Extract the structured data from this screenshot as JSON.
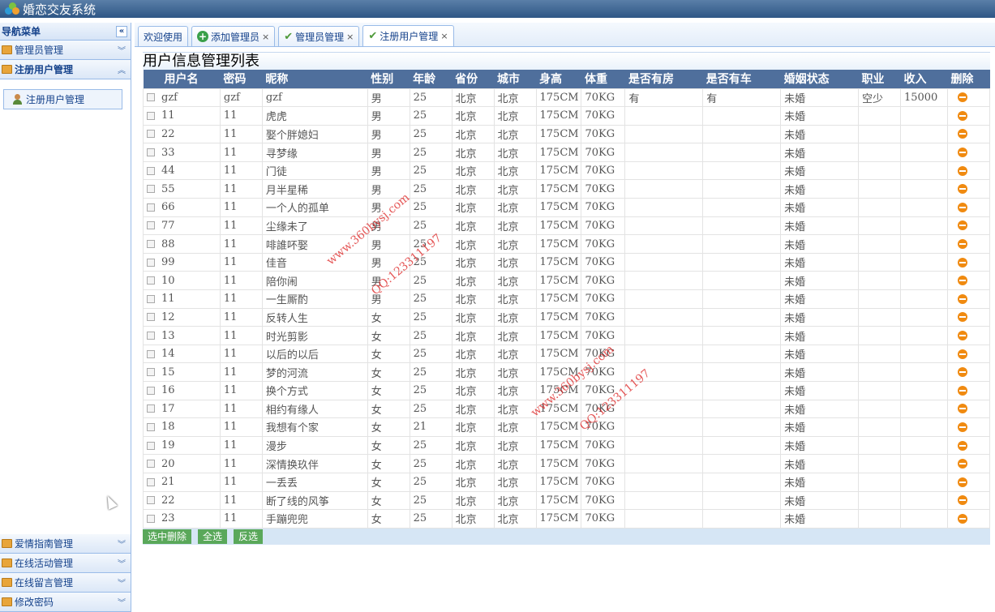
{
  "app": {
    "title": "婚恋交友系统"
  },
  "sidebar": {
    "header": "导航菜单",
    "collapse_glyph": "«",
    "sections": [
      {
        "label": "管理员管理",
        "chevron": "︾"
      },
      {
        "label": "注册用户管理",
        "chevron": "︽"
      }
    ],
    "sub_items": [
      {
        "label": "注册用户管理"
      }
    ],
    "bottom_sections": [
      {
        "label": "爱情指南管理",
        "chevron": "︾"
      },
      {
        "label": "在线活动管理",
        "chevron": "︾"
      },
      {
        "label": "在线留言管理",
        "chevron": "︾"
      },
      {
        "label": "修改密码",
        "chevron": "︾"
      }
    ]
  },
  "tabs": [
    {
      "label": "欢迎使用",
      "icon": "none",
      "closable": false
    },
    {
      "label": "添加管理员",
      "icon": "plus-icon",
      "closable": true
    },
    {
      "label": "管理员管理",
      "icon": "check-icon",
      "closable": true
    },
    {
      "label": "注册用户管理",
      "icon": "check-icon",
      "closable": true,
      "active": true
    }
  ],
  "tab_close_glyph": "×",
  "page": {
    "title": "用户信息管理列表",
    "columns": [
      "用户名",
      "密码",
      "昵称",
      "性别",
      "年龄",
      "省份",
      "城市",
      "身高",
      "体重",
      "是否有房",
      "是否有车",
      "婚姻状态",
      "职业",
      "收入",
      "删除"
    ],
    "rows": [
      [
        "gzf",
        "gzf",
        "gzf",
        "男",
        "25",
        "北京",
        "北京",
        "175CM",
        "70KG",
        "有",
        "有",
        "未婚",
        "空少",
        "15000"
      ],
      [
        "11",
        "11",
        "虎虎",
        "男",
        "25",
        "北京",
        "北京",
        "175CM",
        "70KG",
        "",
        "",
        "未婚",
        "",
        ""
      ],
      [
        "22",
        "11",
        "娶个胖媳妇",
        "男",
        "25",
        "北京",
        "北京",
        "175CM",
        "70KG",
        "",
        "",
        "未婚",
        "",
        ""
      ],
      [
        "33",
        "11",
        "寻梦缘",
        "男",
        "25",
        "北京",
        "北京",
        "175CM",
        "70KG",
        "",
        "",
        "未婚",
        "",
        ""
      ],
      [
        "44",
        "11",
        "门徒",
        "男",
        "25",
        "北京",
        "北京",
        "175CM",
        "70KG",
        "",
        "",
        "未婚",
        "",
        ""
      ],
      [
        "55",
        "11",
        "月半星稀",
        "男",
        "25",
        "北京",
        "北京",
        "175CM",
        "70KG",
        "",
        "",
        "未婚",
        "",
        ""
      ],
      [
        "66",
        "11",
        "一个人的孤单",
        "男",
        "25",
        "北京",
        "北京",
        "175CM",
        "70KG",
        "",
        "",
        "未婚",
        "",
        ""
      ],
      [
        "77",
        "11",
        "尘缘未了",
        "男",
        "25",
        "北京",
        "北京",
        "175CM",
        "70KG",
        "",
        "",
        "未婚",
        "",
        ""
      ],
      [
        "88",
        "11",
        "啡誰吥娶",
        "男",
        "25",
        "北京",
        "北京",
        "175CM",
        "70KG",
        "",
        "",
        "未婚",
        "",
        ""
      ],
      [
        "99",
        "11",
        "佳音",
        "男",
        "25",
        "北京",
        "北京",
        "175CM",
        "70KG",
        "",
        "",
        "未婚",
        "",
        ""
      ],
      [
        "10",
        "11",
        "陪你闹",
        "男",
        "25",
        "北京",
        "北京",
        "175CM",
        "70KG",
        "",
        "",
        "未婚",
        "",
        ""
      ],
      [
        "11",
        "11",
        "一生厮酌",
        "男",
        "25",
        "北京",
        "北京",
        "175CM",
        "70KG",
        "",
        "",
        "未婚",
        "",
        ""
      ],
      [
        "12",
        "11",
        "反转人生",
        "女",
        "25",
        "北京",
        "北京",
        "175CM",
        "70KG",
        "",
        "",
        "未婚",
        "",
        ""
      ],
      [
        "13",
        "11",
        "时光剪影",
        "女",
        "25",
        "北京",
        "北京",
        "175CM",
        "70KG",
        "",
        "",
        "未婚",
        "",
        ""
      ],
      [
        "14",
        "11",
        "以后的以后",
        "女",
        "25",
        "北京",
        "北京",
        "175CM",
        "70KG",
        "",
        "",
        "未婚",
        "",
        ""
      ],
      [
        "15",
        "11",
        "梦的河流",
        "女",
        "25",
        "北京",
        "北京",
        "175CM",
        "70KG",
        "",
        "",
        "未婚",
        "",
        ""
      ],
      [
        "16",
        "11",
        "换个方式",
        "女",
        "25",
        "北京",
        "北京",
        "175CM",
        "70KG",
        "",
        "",
        "未婚",
        "",
        ""
      ],
      [
        "17",
        "11",
        "相约有缘人",
        "女",
        "25",
        "北京",
        "北京",
        "175CM",
        "70KG",
        "",
        "",
        "未婚",
        "",
        ""
      ],
      [
        "18",
        "11",
        "我想有个家",
        "女",
        "21",
        "北京",
        "北京",
        "175CM",
        "70KG",
        "",
        "",
        "未婚",
        "",
        ""
      ],
      [
        "19",
        "11",
        "漫步",
        "女",
        "25",
        "北京",
        "北京",
        "175CM",
        "70KG",
        "",
        "",
        "未婚",
        "",
        ""
      ],
      [
        "20",
        "11",
        "深情换玖伴",
        "女",
        "25",
        "北京",
        "北京",
        "175CM",
        "70KG",
        "",
        "",
        "未婚",
        "",
        ""
      ],
      [
        "21",
        "11",
        "一丢丢",
        "女",
        "25",
        "北京",
        "北京",
        "175CM",
        "70KG",
        "",
        "",
        "未婚",
        "",
        ""
      ],
      [
        "22",
        "11",
        "断了线的风筝",
        "女",
        "25",
        "北京",
        "北京",
        "175CM",
        "70KG",
        "",
        "",
        "未婚",
        "",
        ""
      ],
      [
        "23",
        "11",
        "手蹦兜兜",
        "女",
        "25",
        "北京",
        "北京",
        "175CM",
        "70KG",
        "",
        "",
        "未婚",
        "",
        ""
      ]
    ],
    "actions": {
      "delete_selected": "选中删除",
      "select_all": "全选",
      "invert_select": "反选"
    }
  },
  "watermarks": [
    "www.360bysj.com",
    "QQ:123311197",
    "www.360bysj.com",
    "QQ:123311197"
  ]
}
